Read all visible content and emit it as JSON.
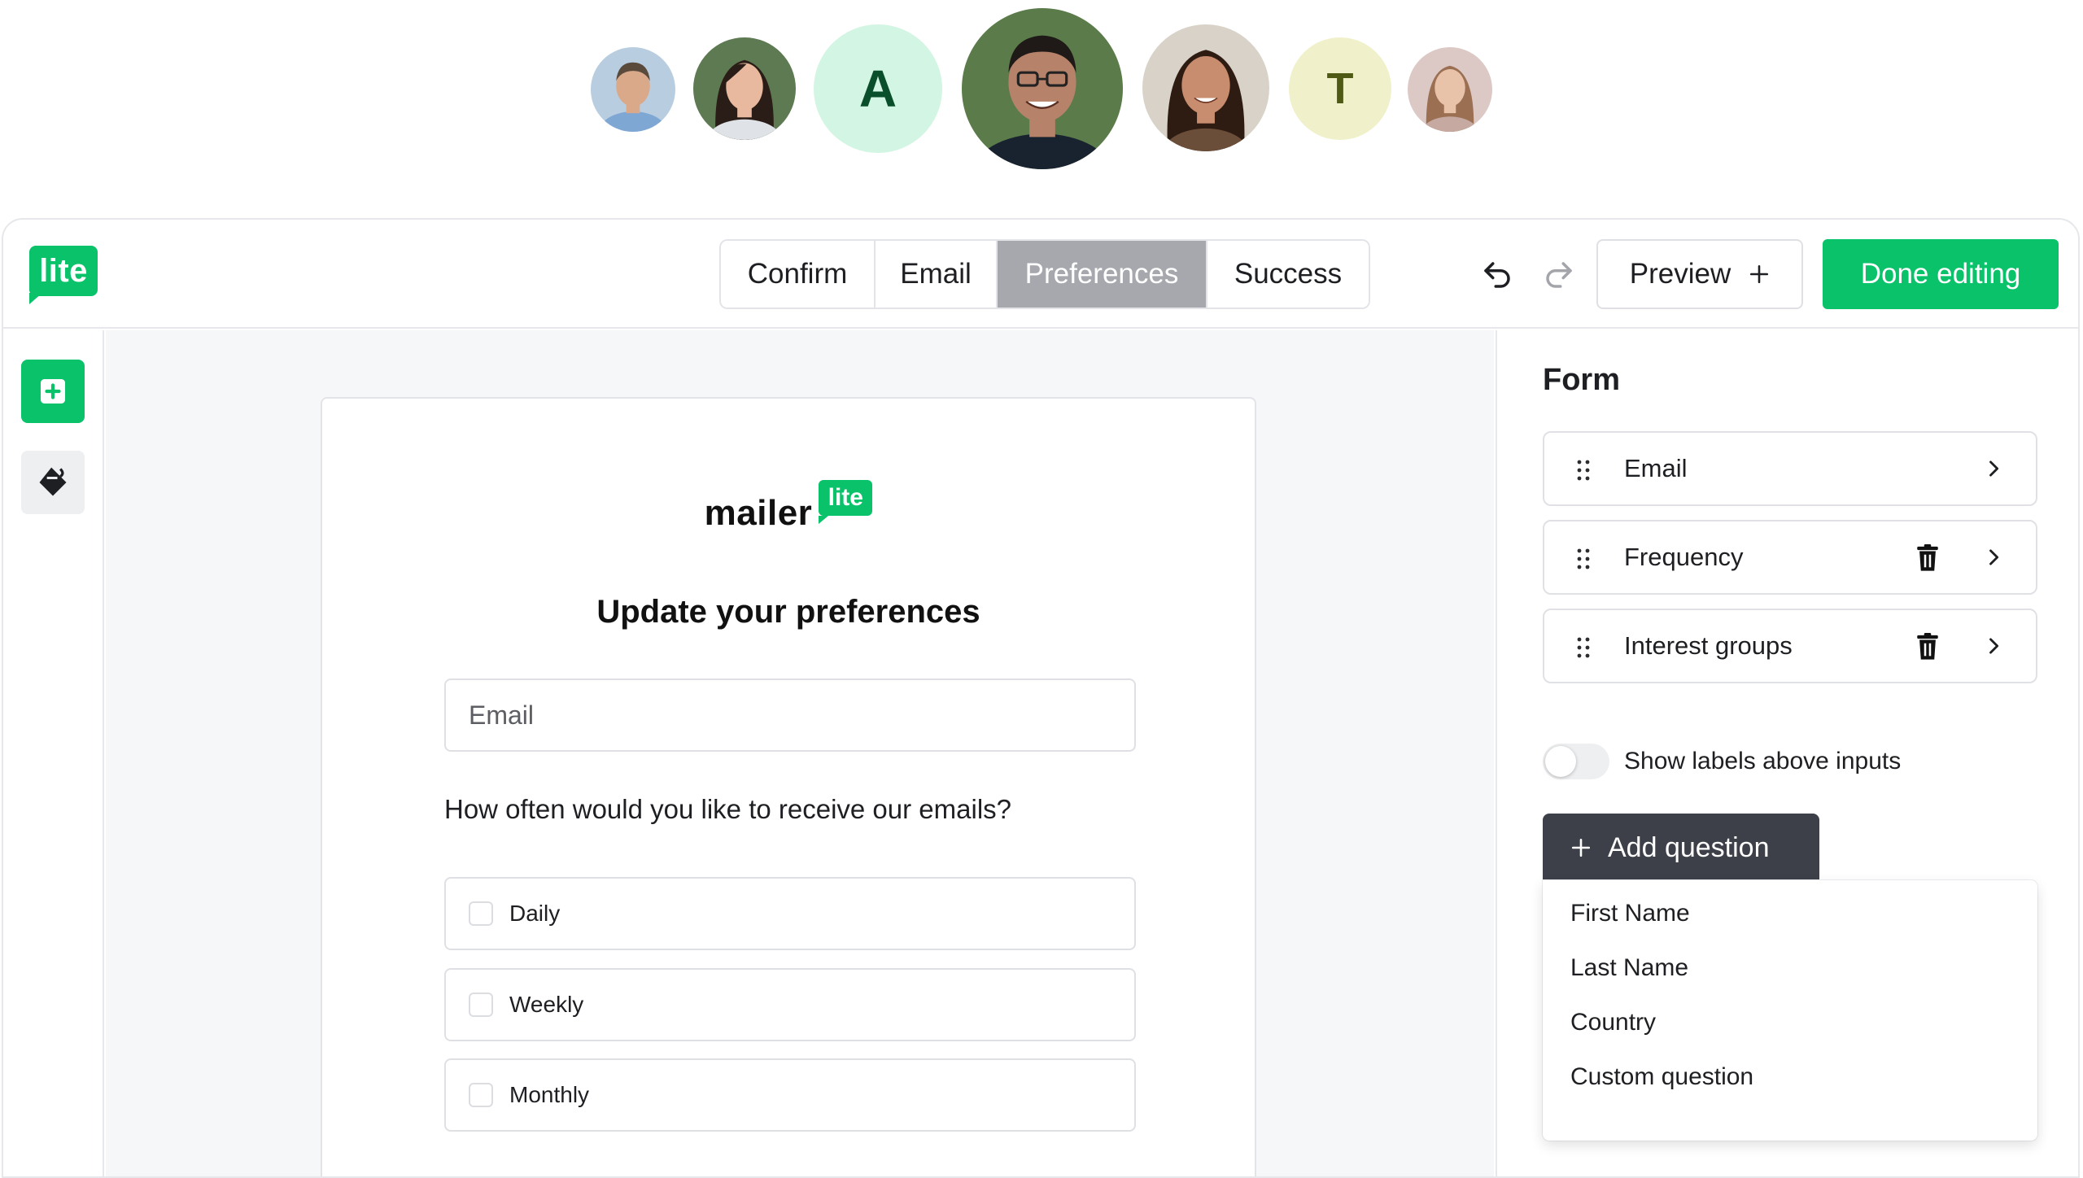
{
  "avatars": [
    {
      "name": "avatar-man-short-hair",
      "type": "photo",
      "bg": "#b9cde0",
      "skin": "#d9a98a",
      "hair": "#5a4a3c",
      "shirt": "#7fa7d4"
    },
    {
      "name": "avatar-woman-dark-hair",
      "type": "photo",
      "bg": "#5e7a52",
      "skin": "#e8b99e",
      "hair": "#2a1d17",
      "shirt": "#dfe3e8"
    },
    {
      "name": "avatar-letter-a",
      "type": "letter",
      "letter": "A",
      "bg": "#d3f5e3",
      "fg": "#0a4f2c"
    },
    {
      "name": "avatar-man-glasses",
      "type": "photo",
      "bg": "#5b7c4a",
      "skin": "#b7826a",
      "hair": "#1f1a18",
      "shirt": "#19232f"
    },
    {
      "name": "avatar-woman-smiling",
      "type": "photo",
      "bg": "#d8d2c8",
      "skin": "#c88d6e",
      "hair": "#2e1c12",
      "shirt": "#6b4e3a"
    },
    {
      "name": "avatar-letter-t",
      "type": "letter",
      "letter": "T",
      "bg": "#f0f1cb",
      "fg": "#4f5a14"
    },
    {
      "name": "avatar-woman-light",
      "type": "photo",
      "bg": "#dcc8c4",
      "skin": "#e9c2aa",
      "hair": "#9a6f52",
      "shirt": "#c6a9a0"
    }
  ],
  "logo": {
    "text": "lite"
  },
  "tabs": [
    {
      "label": "Confirm",
      "active": false
    },
    {
      "label": "Email",
      "active": false
    },
    {
      "label": "Preferences",
      "active": true
    },
    {
      "label": "Success",
      "active": false
    }
  ],
  "toolbar": {
    "undo_icon": "undo-icon",
    "redo_icon": "redo-icon",
    "preview_label": "Preview",
    "preview_icon": "plus-icon",
    "done_label": "Done editing"
  },
  "colors": {
    "brand": "#09c269",
    "active_tab": "#a6a8ad",
    "dark_button": "#3d4048"
  },
  "form": {
    "brand_word": "mailer",
    "brand_badge": "lite",
    "heading": "Update your preferences",
    "email_placeholder": "Email",
    "question": "How often would you like to receive our emails?",
    "options": [
      "Daily",
      "Weekly",
      "Monthly"
    ]
  },
  "panel": {
    "title": "Form",
    "fields": [
      {
        "label": "Email",
        "deletable": false
      },
      {
        "label": "Frequency",
        "deletable": true
      },
      {
        "label": "Interest groups",
        "deletable": true
      }
    ],
    "toggle_label": "Show labels above inputs",
    "toggle_on": false,
    "add_question_label": "Add question",
    "dropdown_items": [
      "First Name",
      "Last Name",
      "Country",
      "Custom question"
    ]
  }
}
